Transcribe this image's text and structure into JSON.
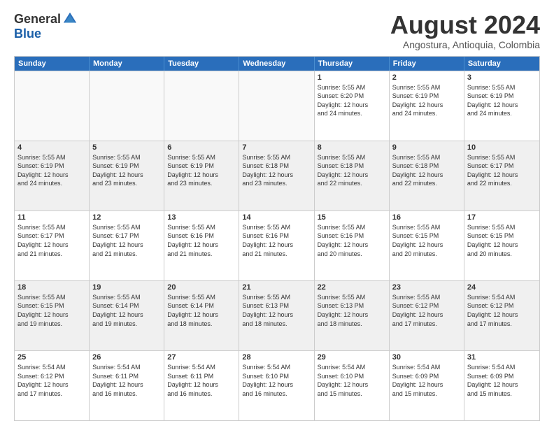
{
  "logo": {
    "general": "General",
    "blue": "Blue"
  },
  "title": "August 2024",
  "location": "Angostura, Antioquia, Colombia",
  "days_of_week": [
    "Sunday",
    "Monday",
    "Tuesday",
    "Wednesday",
    "Thursday",
    "Friday",
    "Saturday"
  ],
  "weeks": [
    [
      {
        "day": "",
        "info": ""
      },
      {
        "day": "",
        "info": ""
      },
      {
        "day": "",
        "info": ""
      },
      {
        "day": "",
        "info": ""
      },
      {
        "day": "1",
        "info": "Sunrise: 5:55 AM\nSunset: 6:20 PM\nDaylight: 12 hours\nand 24 minutes."
      },
      {
        "day": "2",
        "info": "Sunrise: 5:55 AM\nSunset: 6:19 PM\nDaylight: 12 hours\nand 24 minutes."
      },
      {
        "day": "3",
        "info": "Sunrise: 5:55 AM\nSunset: 6:19 PM\nDaylight: 12 hours\nand 24 minutes."
      }
    ],
    [
      {
        "day": "4",
        "info": "Sunrise: 5:55 AM\nSunset: 6:19 PM\nDaylight: 12 hours\nand 24 minutes."
      },
      {
        "day": "5",
        "info": "Sunrise: 5:55 AM\nSunset: 6:19 PM\nDaylight: 12 hours\nand 23 minutes."
      },
      {
        "day": "6",
        "info": "Sunrise: 5:55 AM\nSunset: 6:19 PM\nDaylight: 12 hours\nand 23 minutes."
      },
      {
        "day": "7",
        "info": "Sunrise: 5:55 AM\nSunset: 6:18 PM\nDaylight: 12 hours\nand 23 minutes."
      },
      {
        "day": "8",
        "info": "Sunrise: 5:55 AM\nSunset: 6:18 PM\nDaylight: 12 hours\nand 22 minutes."
      },
      {
        "day": "9",
        "info": "Sunrise: 5:55 AM\nSunset: 6:18 PM\nDaylight: 12 hours\nand 22 minutes."
      },
      {
        "day": "10",
        "info": "Sunrise: 5:55 AM\nSunset: 6:17 PM\nDaylight: 12 hours\nand 22 minutes."
      }
    ],
    [
      {
        "day": "11",
        "info": "Sunrise: 5:55 AM\nSunset: 6:17 PM\nDaylight: 12 hours\nand 21 minutes."
      },
      {
        "day": "12",
        "info": "Sunrise: 5:55 AM\nSunset: 6:17 PM\nDaylight: 12 hours\nand 21 minutes."
      },
      {
        "day": "13",
        "info": "Sunrise: 5:55 AM\nSunset: 6:16 PM\nDaylight: 12 hours\nand 21 minutes."
      },
      {
        "day": "14",
        "info": "Sunrise: 5:55 AM\nSunset: 6:16 PM\nDaylight: 12 hours\nand 21 minutes."
      },
      {
        "day": "15",
        "info": "Sunrise: 5:55 AM\nSunset: 6:16 PM\nDaylight: 12 hours\nand 20 minutes."
      },
      {
        "day": "16",
        "info": "Sunrise: 5:55 AM\nSunset: 6:15 PM\nDaylight: 12 hours\nand 20 minutes."
      },
      {
        "day": "17",
        "info": "Sunrise: 5:55 AM\nSunset: 6:15 PM\nDaylight: 12 hours\nand 20 minutes."
      }
    ],
    [
      {
        "day": "18",
        "info": "Sunrise: 5:55 AM\nSunset: 6:15 PM\nDaylight: 12 hours\nand 19 minutes."
      },
      {
        "day": "19",
        "info": "Sunrise: 5:55 AM\nSunset: 6:14 PM\nDaylight: 12 hours\nand 19 minutes."
      },
      {
        "day": "20",
        "info": "Sunrise: 5:55 AM\nSunset: 6:14 PM\nDaylight: 12 hours\nand 18 minutes."
      },
      {
        "day": "21",
        "info": "Sunrise: 5:55 AM\nSunset: 6:13 PM\nDaylight: 12 hours\nand 18 minutes."
      },
      {
        "day": "22",
        "info": "Sunrise: 5:55 AM\nSunset: 6:13 PM\nDaylight: 12 hours\nand 18 minutes."
      },
      {
        "day": "23",
        "info": "Sunrise: 5:55 AM\nSunset: 6:12 PM\nDaylight: 12 hours\nand 17 minutes."
      },
      {
        "day": "24",
        "info": "Sunrise: 5:54 AM\nSunset: 6:12 PM\nDaylight: 12 hours\nand 17 minutes."
      }
    ],
    [
      {
        "day": "25",
        "info": "Sunrise: 5:54 AM\nSunset: 6:12 PM\nDaylight: 12 hours\nand 17 minutes."
      },
      {
        "day": "26",
        "info": "Sunrise: 5:54 AM\nSunset: 6:11 PM\nDaylight: 12 hours\nand 16 minutes."
      },
      {
        "day": "27",
        "info": "Sunrise: 5:54 AM\nSunset: 6:11 PM\nDaylight: 12 hours\nand 16 minutes."
      },
      {
        "day": "28",
        "info": "Sunrise: 5:54 AM\nSunset: 6:10 PM\nDaylight: 12 hours\nand 16 minutes."
      },
      {
        "day": "29",
        "info": "Sunrise: 5:54 AM\nSunset: 6:10 PM\nDaylight: 12 hours\nand 15 minutes."
      },
      {
        "day": "30",
        "info": "Sunrise: 5:54 AM\nSunset: 6:09 PM\nDaylight: 12 hours\nand 15 minutes."
      },
      {
        "day": "31",
        "info": "Sunrise: 5:54 AM\nSunset: 6:09 PM\nDaylight: 12 hours\nand 15 minutes."
      }
    ]
  ]
}
